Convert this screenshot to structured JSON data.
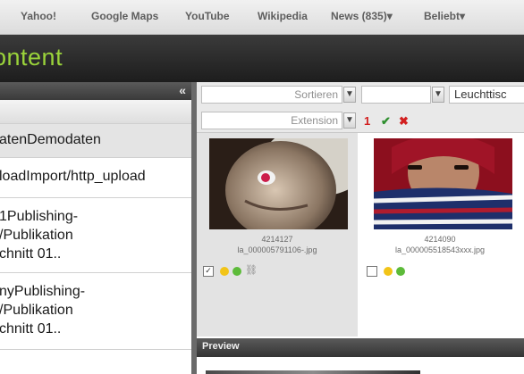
{
  "bookmarks": [
    "Yahoo!",
    "Google Maps",
    "YouTube",
    "Wikipedia",
    "News (835)▾",
    "Beliebt▾"
  ],
  "app": {
    "title": "ontent",
    "accent": "#9ad33a"
  },
  "left_panel": {
    "collapse_icon": "double-chevron-left-icon",
    "items": [
      "atenDemodaten",
      "loadImport/http_upload",
      "1Publishing-\n/Publikation\nchnitt 01..",
      "nyPublishing-\n/Publikation\nchnitt 01.."
    ]
  },
  "toolbar": {
    "sort_placeholder": "Sortieren",
    "view_value": "Leuchttisc",
    "extension_placeholder": "Extension",
    "count": "1",
    "check_icon": "check-icon",
    "clear_icon": "x-icon"
  },
  "assets": [
    {
      "id": "4214127",
      "filename": "la_000005791106-.jpg",
      "selected": true,
      "status_colors": [
        "#f2c418",
        "#5dbb3a"
      ]
    },
    {
      "id": "4214090",
      "filename": "la_000005518543xxx.jpg",
      "selected": false,
      "status_colors": [
        "#f2c418",
        "#5dbb3a"
      ]
    }
  ],
  "preview": {
    "title": "Preview"
  }
}
